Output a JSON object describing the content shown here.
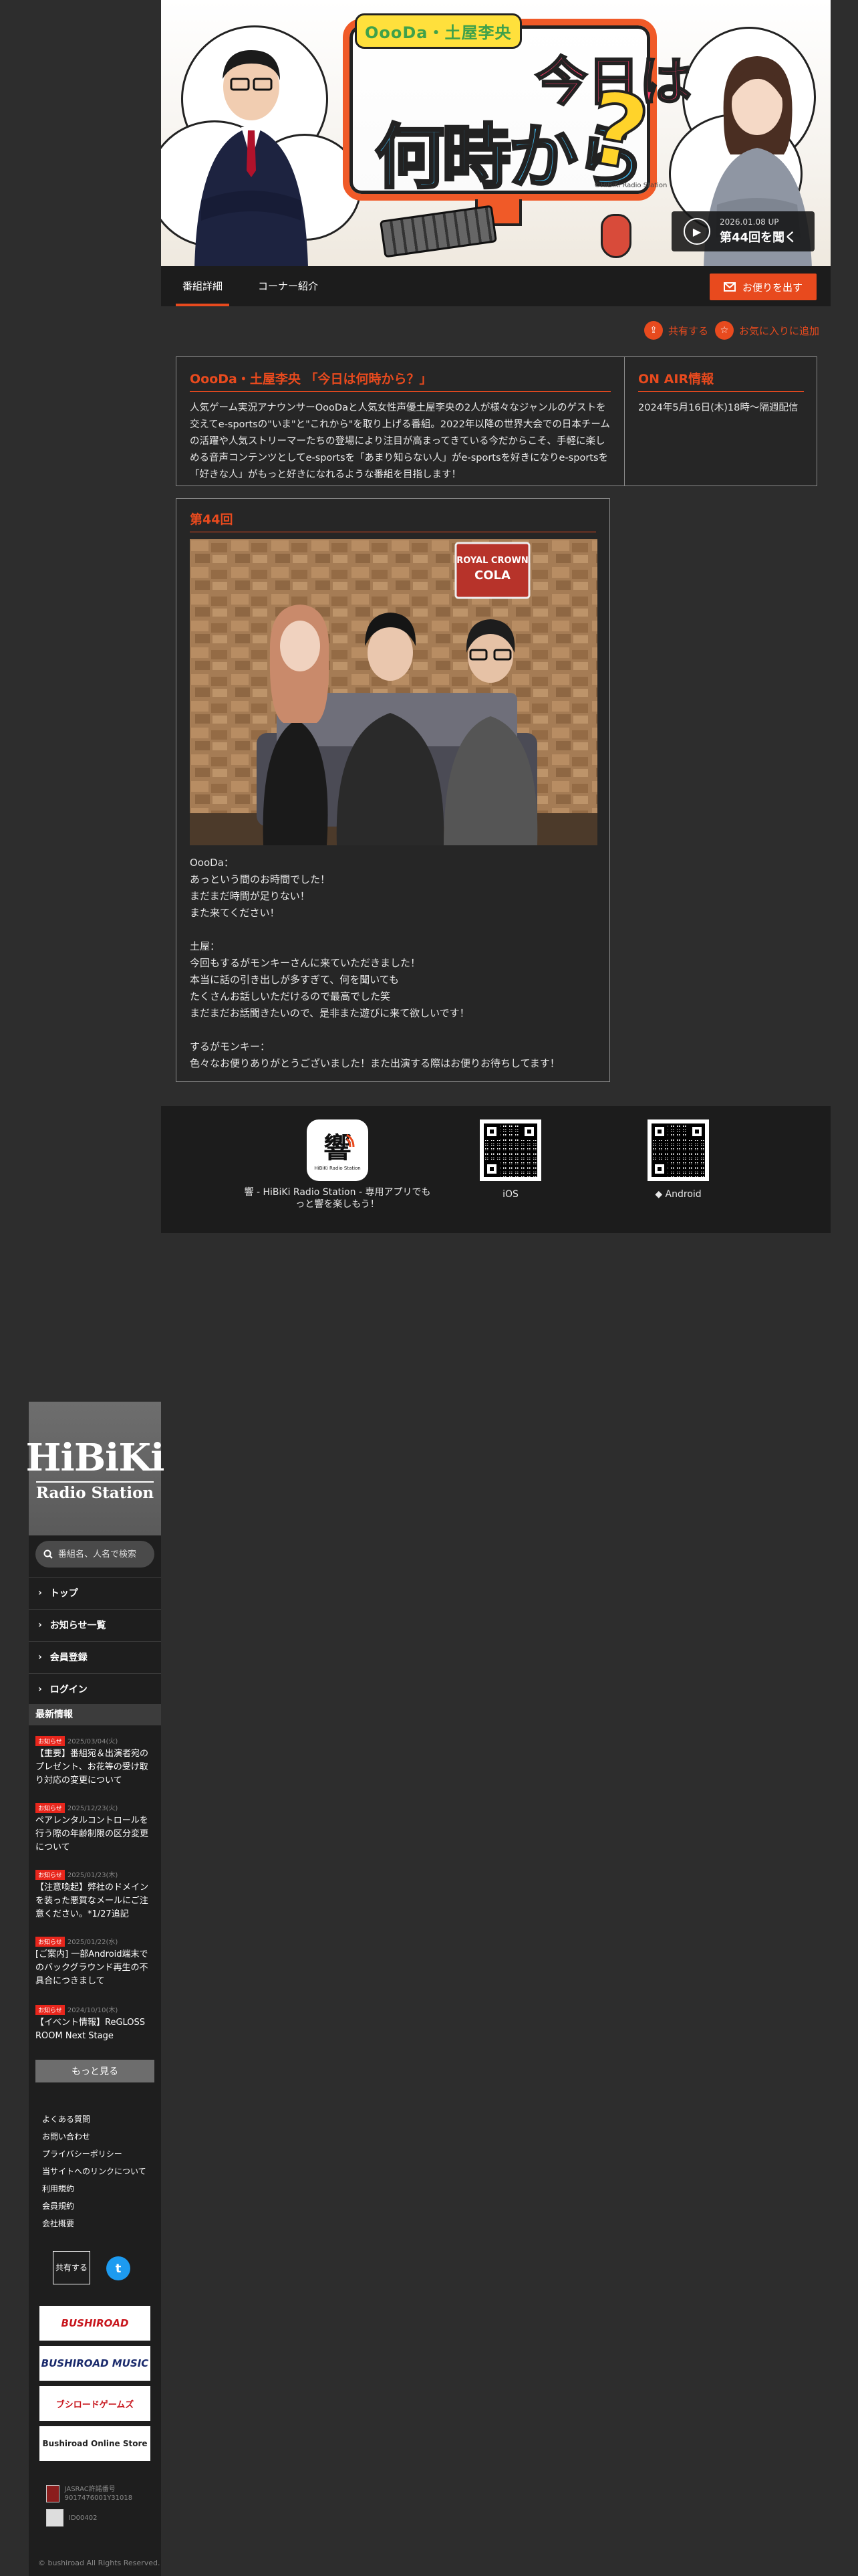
{
  "hero": {
    "logo_small": "OooDa・土屋李央",
    "title_line1": "今日は",
    "title_line2": "何時から",
    "title_mark": "?",
    "credit": "©HiBiKi Radio Station",
    "play_date": "2026.01.08 UP",
    "play_label": "第44回を聞く"
  },
  "tabs": {
    "detail": "番組詳細",
    "corners": "コーナー紹介",
    "letter_button": "お便りを出す"
  },
  "actions": {
    "share": "共有する",
    "favorite": "お気に入りに追加"
  },
  "program": {
    "title": "OooDa・土屋李央 「今日は何時から？」",
    "description": "人気ゲーム実況アナウンサーOooDaと人気女性声優土屋李央の2人が様々なジャンルのゲストを交えてe-sportsの\"いま\"と\"これから\"を取り上げる番組。2022年以降の世界大会での日本チームの活躍や人気ストリーマーたちの登場により注目が高まってきている今だからこそ、手軽に楽しめる音声コンテンツとしてe-sportsを「あまり知らない人」がe-sportsを好きになりe-sportsを「好きな人」がもっと好きになれるような番組を目指します！",
    "onair_title": "ON AIR情報",
    "onair_text": "2024年5月16日(木)18時〜隔週配信"
  },
  "episode": {
    "title": "第44回",
    "photo_sign_line1": "ROYAL CROWN",
    "photo_sign_line2": "COLA",
    "text": "OooDa：\nあっという間のお時間でした！\nまだまだ時間が足りない！\nまた来てください！\n\n土屋：\n今回もするがモンキーさんに来ていただきました！\n本当に話の引き出しが多すぎて、何を聞いても\nたくさんお話しいただけるので最高でした笑\nまだまだお話聞きたいので、是非また遊びに来て欲しいです！\n\nするがモンキー：\n色々なお便りありがとうございました！また出演する際はお便りお待ちしてます！"
  },
  "apps": {
    "app_icon_label": "HiBiKi Radio Station",
    "caption": "響 - HiBiKi Radio Station - 専用アプリでもっと響を楽しもう！",
    "ios": "iOS",
    "android": "Android"
  },
  "sidebar": {
    "logo_line1": "HiBiKi",
    "logo_line2": "Radio Station",
    "search_placeholder": "番組名、人名で検索",
    "nav": [
      "トップ",
      "お知らせ一覧",
      "会員登録",
      "ログイン"
    ],
    "news_heading": "最新情報",
    "news": [
      {
        "badge": "お知らせ",
        "date": "2025/03/04(火)",
        "title": "【重要】番組宛＆出演者宛のプレゼント、お花等の受け取り対応の変更について"
      },
      {
        "badge": "お知らせ",
        "date": "2025/12/23(火)",
        "title": "ペアレンタルコントロールを行う際の年齢制限の区分変更について"
      },
      {
        "badge": "お知らせ",
        "date": "2025/01/23(木)",
        "title": "【注意喚起】弊社のドメインを装った悪質なメールにご注意ください。*1/27追記"
      },
      {
        "badge": "お知らせ",
        "date": "2025/01/22(水)",
        "title": "[ご案内] 一部Android端末でのバックグラウンド再生の不具合につきまして"
      },
      {
        "badge": "お知らせ",
        "date": "2024/10/10(木)",
        "title": "【イベント情報】ReGLOSS ROOM Next Stage"
      }
    ],
    "more": "もっと見る",
    "footer_links": [
      "よくある質問",
      "お問い合わせ",
      "プライバシーポリシー",
      "当サイトへのリンクについて",
      "利用規約",
      "会員規約",
      "会社概要"
    ],
    "share": "共有する",
    "twitter": "t",
    "banners": [
      "BUSHIROAD",
      "BUSHIROAD MUSIC",
      "ブシロードゲームズ",
      "Bushiroad Online Store"
    ],
    "jasrac": "JASRAC許諾番号 9017476001Y31018",
    "nextone": "ID00402",
    "copyright": "© bushiroad All Rights Reserved."
  }
}
